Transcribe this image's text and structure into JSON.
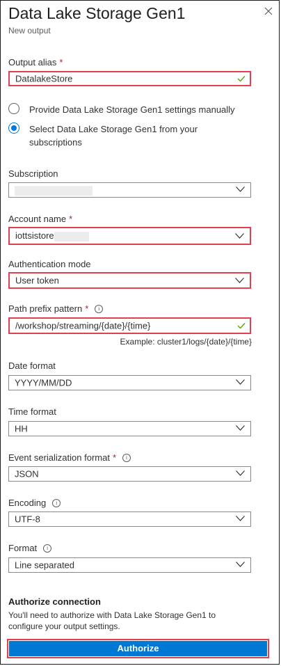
{
  "header": {
    "title": "Data Lake Storage Gen1",
    "subtitle": "New output"
  },
  "output_alias": {
    "label": "Output alias",
    "required": "*",
    "value": "DatalakeStore"
  },
  "source_options": [
    {
      "label": "Provide Data Lake Storage Gen1 settings manually",
      "selected": false
    },
    {
      "label": "Select Data Lake Storage Gen1 from your subscriptions",
      "selected": true
    }
  ],
  "subscription": {
    "label": "Subscription",
    "value": ""
  },
  "account_name": {
    "label": "Account name",
    "required": "*",
    "value": "iottsistore"
  },
  "auth_mode": {
    "label": "Authentication mode",
    "value": "User token"
  },
  "path_prefix": {
    "label": "Path prefix pattern",
    "required": "*",
    "value": "/workshop/streaming/{date}/{time}",
    "example": "Example: cluster1/logs/{date}/{time}"
  },
  "date_format": {
    "label": "Date format",
    "value": "YYYY/MM/DD"
  },
  "time_format": {
    "label": "Time format",
    "value": "HH"
  },
  "event_serialization": {
    "label": "Event serialization format",
    "required": "*",
    "value": "JSON"
  },
  "encoding": {
    "label": "Encoding",
    "value": "UTF-8"
  },
  "format": {
    "label": "Format",
    "value": "Line separated"
  },
  "authorize": {
    "heading": "Authorize connection",
    "description": "You'll need to authorize with Data Lake Storage Gen1 to configure your output settings.",
    "button_label": "Authorize"
  },
  "colors": {
    "accent": "#0078d4",
    "highlight": "#e04050",
    "required": "#a4262c",
    "valid": "#57a300"
  },
  "icons": {
    "close": "close-icon",
    "info": "info-icon",
    "dropdown": "chevron-down-icon",
    "valid": "checkmark-icon"
  }
}
